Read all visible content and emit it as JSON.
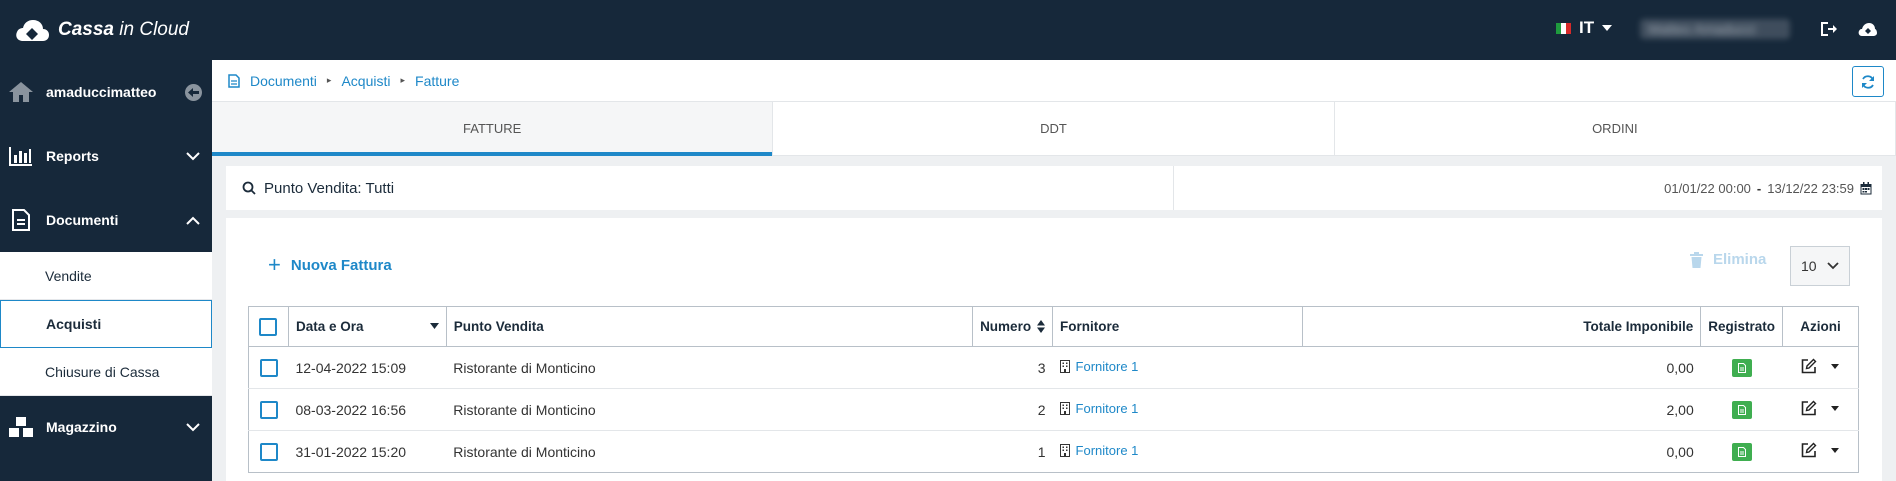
{
  "app": {
    "logo_bold": "Cassa",
    "logo_light": "in Cloud"
  },
  "topbar": {
    "language": "IT",
    "user_name": "Matteo Amaducci"
  },
  "sidebar": {
    "account": "amaduccimatteo",
    "sections": [
      {
        "label": "Reports"
      },
      {
        "label": "Documenti"
      },
      {
        "label": "Magazzino"
      }
    ],
    "documenti_items": [
      {
        "label": "Vendite"
      },
      {
        "label": "Acquisti"
      },
      {
        "label": "Chiusure di Cassa"
      }
    ]
  },
  "breadcrumb": [
    "Documenti",
    "Acquisti",
    "Fatture"
  ],
  "tabs": [
    "FATTURE",
    "DDT",
    "ORDINI"
  ],
  "filter": {
    "point_of_sale": "Punto Vendita: Tutti",
    "date_from": "01/01/22 00:00",
    "date_to": "13/12/22 23:59"
  },
  "toolbar": {
    "new_label": "Nuova Fattura",
    "delete_label": "Elimina",
    "page_size": "10"
  },
  "table": {
    "columns": [
      "Data e Ora",
      "Punto Vendita",
      "Numero",
      "Fornitore",
      "Totale Imponibile",
      "Registrato",
      "Azioni"
    ],
    "rows": [
      {
        "date": "12-04-2022 15:09",
        "pos": "Ristorante di Monticino",
        "number": "3",
        "supplier": "Fornitore 1",
        "total": "0,00"
      },
      {
        "date": "08-03-2022 16:56",
        "pos": "Ristorante di Monticino",
        "number": "2",
        "supplier": "Fornitore 1",
        "total": "2,00"
      },
      {
        "date": "31-01-2022 15:20",
        "pos": "Ristorante di Monticino",
        "number": "1",
        "supplier": "Fornitore 1",
        "total": "0,00"
      }
    ]
  },
  "colors": {
    "topbar": "#16283a",
    "accent": "#1e88c8",
    "registered": "#3fae50"
  }
}
